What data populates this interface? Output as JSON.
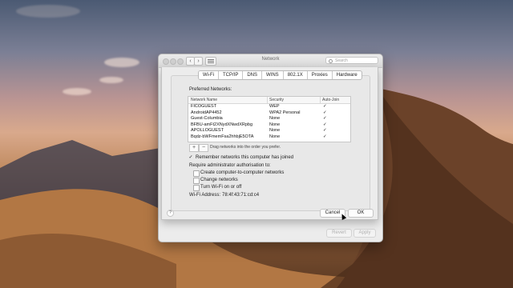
{
  "window": {
    "title": "Network",
    "search_placeholder": "Search"
  },
  "tabs": [
    "Wi-Fi",
    "TCP/IP",
    "DNS",
    "WINS",
    "802.1X",
    "Proxies",
    "Hardware"
  ],
  "selected_tab": "Wi-Fi",
  "preferred": {
    "heading": "Preferred Networks:",
    "columns": [
      "Network Name",
      "Security",
      "Auto-Join"
    ],
    "rows": [
      {
        "name": "FICOGUEST",
        "security": "WEP",
        "auto": "✓"
      },
      {
        "name": "AndroidAP4452",
        "security": "WPA2 Personal",
        "auto": "✓"
      },
      {
        "name": "Guest-Columbia",
        "security": "None",
        "auto": "✓"
      },
      {
        "name": "BFBU-amFt2XNydXNwdXRpbg",
        "security": "None",
        "auto": "✓"
      },
      {
        "name": "APOLLOGUEST",
        "security": "None",
        "auto": "✓"
      },
      {
        "name": "Bqdz-bWFmemFsa2hhbjE5OTA",
        "security": "None",
        "auto": "✓"
      }
    ],
    "add_label": "+",
    "remove_label": "−",
    "drag_hint": "Drag networks into the order you prefer."
  },
  "remember": {
    "label": "Remember networks this computer has joined",
    "checked": "✓"
  },
  "admin": {
    "heading": "Require administrator authorisation to:",
    "options": [
      "Create computer-to-computer networks",
      "Change networks",
      "Turn Wi-Fi on or off"
    ]
  },
  "wifi_address": {
    "label": "Wi-Fi Address:",
    "value": "78:4f:43:71:cd:c4"
  },
  "buttons": {
    "help": "?",
    "cancel": "Cancel",
    "ok": "OK",
    "revert": "Revert",
    "apply": "Apply"
  }
}
